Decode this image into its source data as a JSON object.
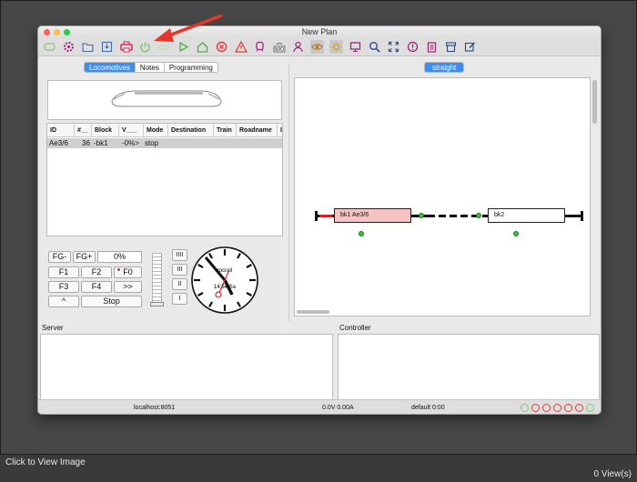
{
  "window": {
    "title": "New Plan"
  },
  "toolbar": {
    "items": [
      "undo-icon",
      "settings-icon",
      "open-folder-icon",
      "save-icon",
      "print-icon",
      "power-icon",
      "connect-icon",
      "play-icon",
      "home-icon",
      "stop-icon",
      "warning-icon",
      "train-icon",
      "wio-icon",
      "user-icon",
      "eye-icon",
      "sun-icon",
      "monitor-icon",
      "search-icon",
      "fullscreen-icon",
      "info-icon",
      "clipboard-icon",
      "archive-icon",
      "edit-icon"
    ]
  },
  "left": {
    "tabs": [
      "Locomotives",
      "Notes",
      "Programming"
    ],
    "active_tab": "Locomotives",
    "table": {
      "columns": [
        "ID",
        "#__",
        "Block",
        "V___",
        "Mode",
        "Destination",
        "Train",
        "Roadname",
        "I"
      ],
      "rows": [
        [
          "Ae3/6",
          "36",
          "-bk1",
          "-0%>",
          "stop",
          "",
          "",
          "",
          ""
        ]
      ]
    },
    "controls": {
      "fg_minus": "FG-",
      "fg_plus": "FG+",
      "speed": "0%",
      "f1": "F1",
      "f2": "F2",
      "f0": "F0",
      "f3": "F3",
      "f4": "F4",
      "fwd": ">>",
      "caret": "^",
      "stop": "Stop",
      "gears": [
        "IIII",
        "III",
        "II",
        "I"
      ]
    },
    "clock": {
      "brand": "rocrail",
      "time": "14:54 Sa"
    }
  },
  "right": {
    "tab": "straight",
    "blocks": [
      {
        "label": "bk1 Ae3/6",
        "color": "#f6c3c3"
      },
      {
        "label": "bk2",
        "color": "#ffffff"
      }
    ]
  },
  "panes": {
    "server": "Server",
    "controller": "Controller"
  },
  "status": {
    "host": "localhost:8051",
    "power": "0.0V 0.00A",
    "mode": "default 0:00"
  },
  "annotation": {
    "arrow_color": "#e8352a"
  },
  "footer": {
    "left": "Click to View Image",
    "right": "0 View(s)"
  }
}
